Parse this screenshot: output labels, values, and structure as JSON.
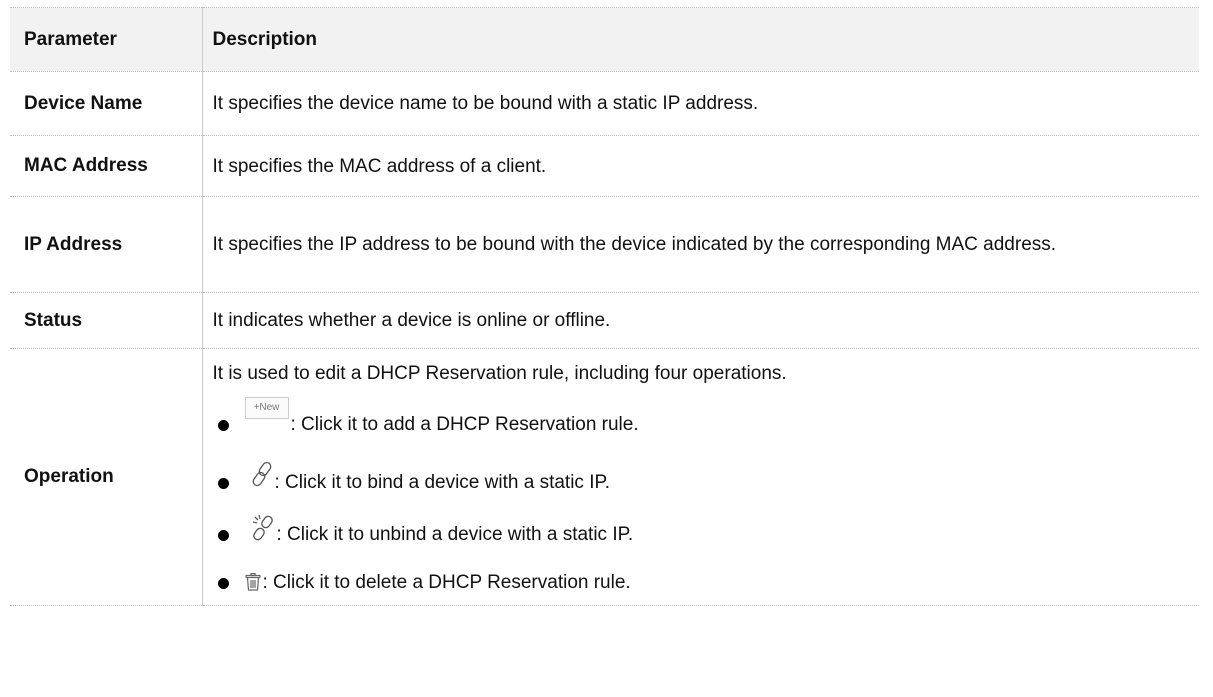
{
  "table": {
    "header": {
      "parameter": "Parameter",
      "description": "Description"
    },
    "rows": [
      {
        "parameter": "Device Name",
        "description": "It specifies the device name to be bound with a static IP address."
      },
      {
        "parameter": "MAC Address",
        "description": "It specifies the MAC address of a client."
      },
      {
        "parameter": "IP Address",
        "description": "It specifies the IP address to be bound with the device indicated by the corresponding MAC address."
      },
      {
        "parameter": "Status",
        "description": "It indicates whether a device is online or offline."
      }
    ],
    "operation": {
      "parameter": "Operation",
      "intro": "It is used to edit a DHCP Reservation rule, including four operations.",
      "items": [
        {
          "icon": "new-button-icon",
          "icon_label": "+New",
          "text": ": Click it to add a DHCP Reservation rule."
        },
        {
          "icon": "link-icon",
          "text": ": Click it to bind a device with a static IP."
        },
        {
          "icon": "broken-link-icon",
          "text": ": Click it to unbind a device with a static IP."
        },
        {
          "icon": "trash-icon",
          "text": ": Click it to delete a DHCP Reservation rule."
        }
      ]
    }
  },
  "colors": {
    "header_bg": "#f2f2f2",
    "text": "#111111",
    "border": "#bdbdbd"
  }
}
